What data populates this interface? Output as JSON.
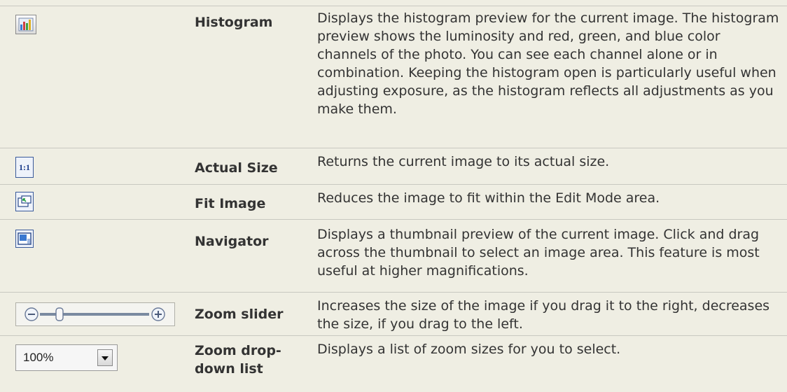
{
  "rows": [
    {
      "icon": "histogram-icon",
      "name": "Histogram",
      "description": "Displays the histogram preview for the current image. The histogram preview shows the luminosity and red, green, and blue color channels of the photo. You can see each channel alone or in combination. Keeping the histogram open is particularly useful when adjusting exposure, as the histogram reflects all adjustments as you make them."
    },
    {
      "icon": "actual-size-icon",
      "icon_text": "1:1",
      "name": "Actual Size",
      "description": "Returns the current image to its actual size."
    },
    {
      "icon": "fit-image-icon",
      "name": "Fit Image",
      "description": "Reduces the image to fit within the Edit Mode area."
    },
    {
      "icon": "navigator-icon",
      "name": "Navigator",
      "description": "Displays a thumbnail preview of the current image. Click and drag across the thumbnail to select an image area. This feature is most useful at higher magnifications."
    },
    {
      "icon": "zoom-slider-icon",
      "name": "Zoom slider",
      "description": "Increases the size of the image if you drag it to the right, decreases the size, if you drag to the left."
    },
    {
      "icon": "zoom-dropdown-icon",
      "dropdown_value": "100%",
      "name": "Zoom drop-down list",
      "description": "Displays a list of zoom sizes for you to select."
    }
  ]
}
